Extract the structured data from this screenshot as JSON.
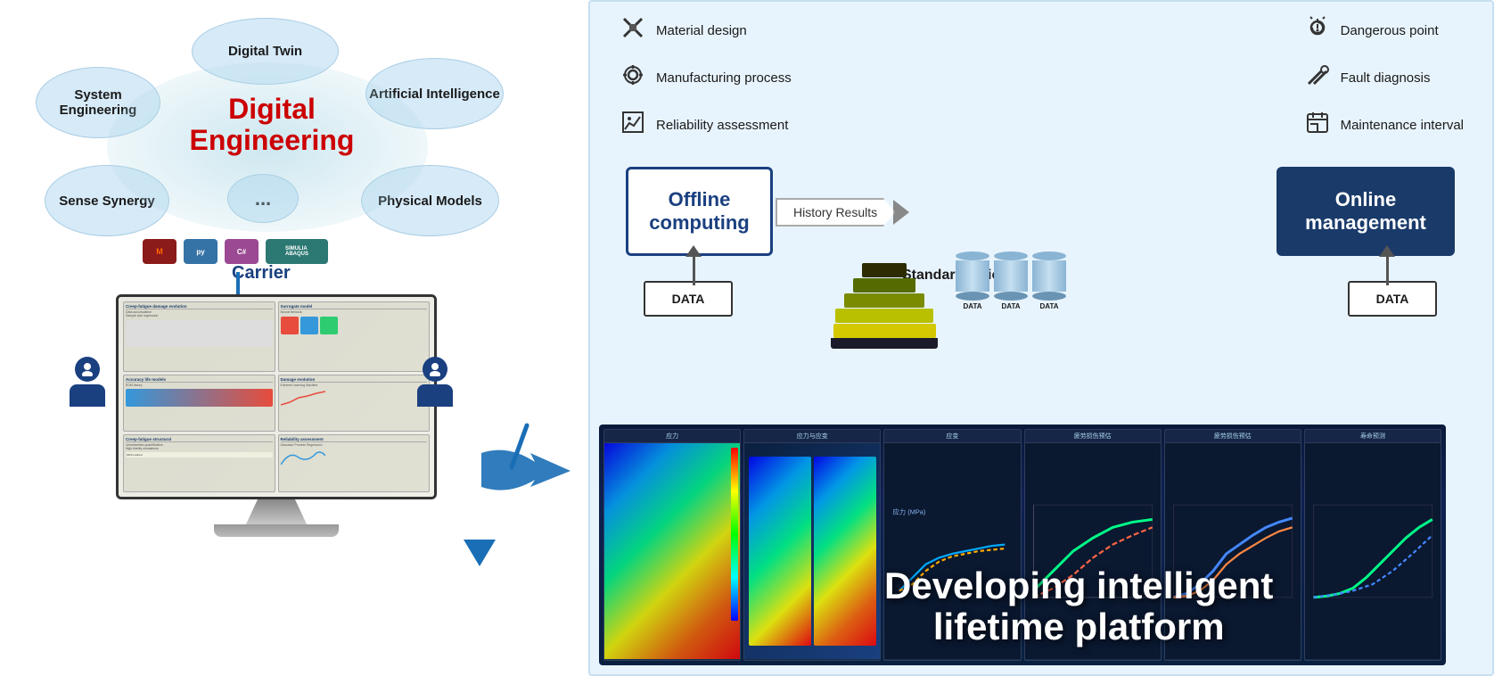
{
  "left": {
    "bubbles": [
      {
        "id": "digital-twin",
        "label": "Digital Twin"
      },
      {
        "id": "artificial-intelligence",
        "label": "Artificial Intelligence"
      },
      {
        "id": "system-engineering",
        "label": "System Engineering"
      },
      {
        "id": "sense-synergy",
        "label": "Sense Synergy"
      },
      {
        "id": "physical-models",
        "label": "Physical Models"
      },
      {
        "id": "dots",
        "label": "..."
      }
    ],
    "center_title": "Digital Engineering",
    "carrier_label": "Carrier",
    "logos": [
      "MATLAB",
      "python",
      "C#",
      "SIMULIA ABAQUS"
    ]
  },
  "right": {
    "top_icons": [
      {
        "icon": "⚙️",
        "label": "Material design"
      },
      {
        "icon": "🔧",
        "label": "Manufacturing process"
      },
      {
        "icon": "📊",
        "label": "Reliability assessment"
      },
      {
        "icon": "🔔",
        "label": "Dangerous point"
      },
      {
        "icon": "🔨",
        "label": "Fault diagnosis"
      },
      {
        "icon": "📋",
        "label": "Maintenance interval"
      }
    ],
    "offline_box": {
      "title": "Offline computing"
    },
    "online_box": {
      "title": "Online management"
    },
    "history_label": "History Results",
    "standardization_label": "Standardization",
    "data_left": "DATA",
    "data_right": "DATA",
    "data_db_labels": [
      "DATA",
      "DATA",
      "DATA"
    ],
    "bottom_text": "Developing intelligent\nlifetime platform",
    "chart_titles": [
      "应力",
      "应力与应变",
      "应变",
      "疲劳损伤预估",
      "疲劳损伤预估",
      "寿命预测"
    ]
  }
}
